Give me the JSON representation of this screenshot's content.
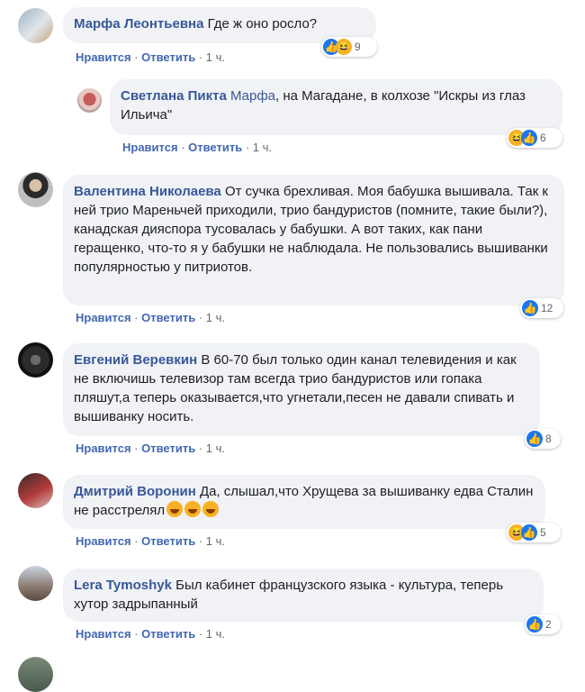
{
  "actions": {
    "like": "Нравится",
    "reply": "Ответить",
    "sep": " · "
  },
  "comments": [
    {
      "author": "Марфа Леонтьевна",
      "text": "Где ж оно росло?",
      "time": "1 ч.",
      "reactions_count": "9"
    },
    {
      "author": "Светлана Пикта",
      "mention": "Марфа",
      "text": ", на Магадане, в колхозе \"Искры из глаз Ильича\"",
      "time": "1 ч.",
      "reactions_count": "6"
    },
    {
      "author": "Валентина Николаева",
      "text": "От сучка брехливая. Моя бабушка вышивала. Так к ней трио Мареньчей приходили, трио бандуристов (помните, такие были?), канадская дияспора тусовалась у бабушки. А вот таких, как пани геращенко, что-то я у бабушки не наблюдала. Не пользовались вышиванки популярностью у питриотов.",
      "time": "1 ч.",
      "reactions_count": "12"
    },
    {
      "author": "Евгений Веревкин",
      "text": "В 60-70 был только один канал телевидения и как не включишь телевизор там всегда трио бандуристов или гопака пляшут,а теперь оказывается,что угнетали,песен не давали спивать и вышиванку носить.",
      "time": "1 ч.",
      "reactions_count": "8"
    },
    {
      "author": "Дмитрий Воронин",
      "text": "Да, слышал,что Хрущева за вышиванку едва Сталин не расстрелял",
      "time": "1 ч.",
      "reactions_count": "5"
    },
    {
      "author": "Lera Tymoshyk",
      "text": "Был кабинет французского языка - культура, теперь хутор задрыпанный",
      "time": "1 ч.",
      "reactions_count": "2"
    }
  ],
  "icons": {
    "like": "like-reaction-icon",
    "haha": "haha-reaction-icon",
    "avatar": "avatar"
  },
  "colors": {
    "author": "#385898",
    "action": "#4267b2",
    "bubble": "#f0f2f5",
    "like": "#1877f2",
    "haha": "#f7b125"
  }
}
